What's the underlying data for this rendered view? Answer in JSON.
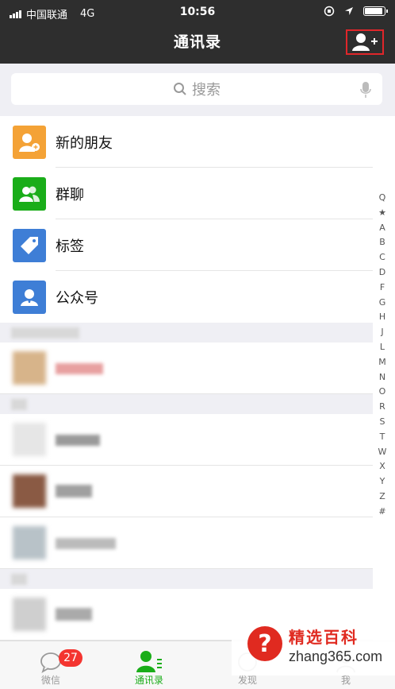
{
  "status_bar": {
    "carrier": "中国联通",
    "network": "4G",
    "time": "10:56"
  },
  "header": {
    "title": "通讯录",
    "add_contact_icon": "add-contact-icon"
  },
  "search": {
    "placeholder": "搜索",
    "search_icon": "search-icon",
    "mic_icon": "microphone-icon"
  },
  "menu_items": [
    {
      "label": "新的朋友",
      "icon": "new-friends-icon",
      "color": "#f4a236"
    },
    {
      "label": "群聊",
      "icon": "group-chat-icon",
      "color": "#1aad19"
    },
    {
      "label": "标签",
      "icon": "tag-icon",
      "color": "#3e7ed6"
    },
    {
      "label": "公众号",
      "icon": "official-account-icon",
      "color": "#3e7ed6"
    }
  ],
  "index": [
    "Q",
    "★",
    "A",
    "B",
    "C",
    "D",
    "F",
    "G",
    "H",
    "J",
    "L",
    "M",
    "N",
    "O",
    "R",
    "S",
    "T",
    "W",
    "X",
    "Y",
    "Z",
    "#"
  ],
  "tabbar": {
    "tabs": [
      {
        "label": "微信",
        "icon": "chat-icon",
        "badge": "27"
      },
      {
        "label": "通讯录",
        "icon": "contacts-icon"
      },
      {
        "label": "发现",
        "icon": "discover-icon"
      },
      {
        "label": "我",
        "icon": "me-icon"
      }
    ],
    "active_color": "#1aad19"
  },
  "watermark": {
    "logo_glyph": "?",
    "title": "精选百科",
    "url": "zhang365.com"
  },
  "colors": {
    "header_bg": "#2e2e2e",
    "highlight_border": "#e0262a",
    "badge": "#f43530"
  }
}
